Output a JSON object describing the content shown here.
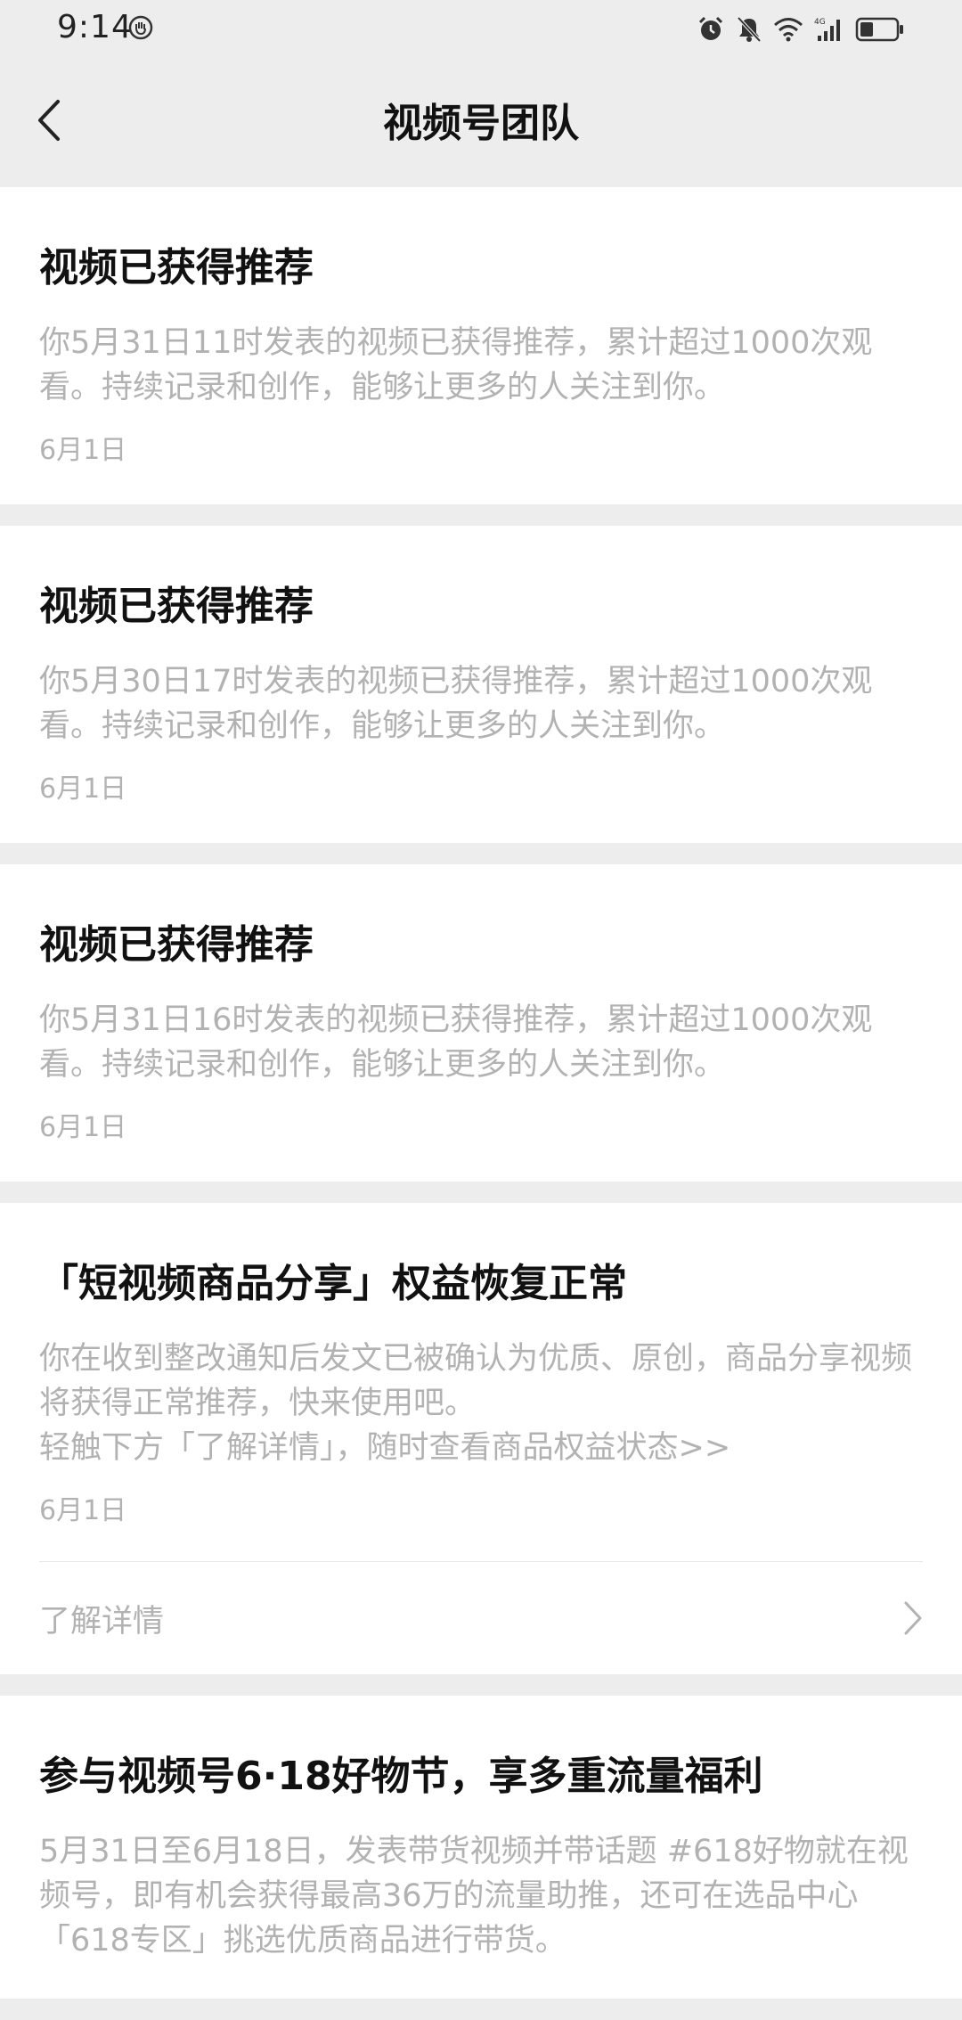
{
  "status_bar": {
    "time": "9:14",
    "icons": [
      "hand-icon",
      "alarm-icon",
      "mute-icon",
      "wifi-icon",
      "4g-signal-icon",
      "battery-icon"
    ]
  },
  "nav": {
    "title": "视频号团队",
    "back_icon": "chevron-left-icon"
  },
  "cards": [
    {
      "title": "视频已获得推荐",
      "body": [
        "你5月31日11时发表的视频已获得推荐，累计超过1000次观看。持续记录和创作，能够让更多的人关注到你。"
      ],
      "date": "6月1日"
    },
    {
      "title": "视频已获得推荐",
      "body": [
        "你5月30日17时发表的视频已获得推荐，累计超过1000次观看。持续记录和创作，能够让更多的人关注到你。"
      ],
      "date": "6月1日"
    },
    {
      "title": "视频已获得推荐",
      "body": [
        "你5月31日16时发表的视频已获得推荐，累计超过1000次观看。持续记录和创作，能够让更多的人关注到你。"
      ],
      "date": "6月1日"
    },
    {
      "title": "「短视频商品分享」权益恢复正常",
      "body": [
        "你在收到整改通知后发文已被确认为优质、原创，商品分享视频将获得正常推荐，快来使用吧。",
        "轻触下方「了解详情」，随时查看商品权益状态>>"
      ],
      "date": "6月1日",
      "link_label": "了解详情"
    },
    {
      "title": "参与视频号6·18好物节，享多重流量福利",
      "body": [
        "5月31日至6月18日，发表带货视频并带话题 #618好物就在视频号，即有机会获得最高36万的流量助推，还可在选品中心「618专区」挑选优质商品进行带货。"
      ],
      "date": ""
    }
  ]
}
